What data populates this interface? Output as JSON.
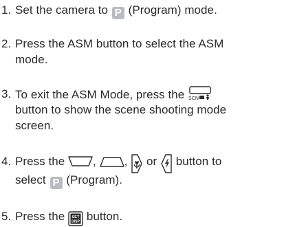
{
  "steps": [
    {
      "num": "1.",
      "lines": [
        {
          "pre": "Set the camera to",
          "mode_icon": "P",
          "post": "(Program) mode."
        }
      ]
    },
    {
      "num": "2.",
      "lines": [
        {
          "text": "Press the ASM button to select the ASM"
        },
        {
          "text": "mode."
        }
      ]
    },
    {
      "num": "3.",
      "lines": [
        {
          "pre": "To exit the ASM Mode, press the",
          "icon": "scn-button-icon"
        },
        {
          "text": "button to show the scene shooting mode"
        },
        {
          "text": "screen."
        }
      ]
    },
    {
      "num": "4.",
      "lines": [
        {
          "pre": "Press the",
          "icons": [
            "down-arrow-button-icon",
            "up-arrow-button-icon",
            "macro-right-button-icon",
            "flash-left-button-icon"
          ],
          "sep1": ",",
          "sep2": ",",
          "or": "or",
          "post": "button to"
        },
        {
          "pre": "select",
          "mode_icon": "P",
          "post": "(Program)."
        }
      ]
    },
    {
      "num": "5.",
      "lines": [
        {
          "pre": "Press the",
          "icon": "set-disp-button-icon",
          "post": "button."
        }
      ]
    }
  ],
  "icon_labels": {
    "scn": "SCN",
    "set": "SET",
    "disp": "DISP"
  },
  "colors": {
    "text": "#2b2b2b",
    "mode_icon_bg": "#b7bcc2"
  }
}
